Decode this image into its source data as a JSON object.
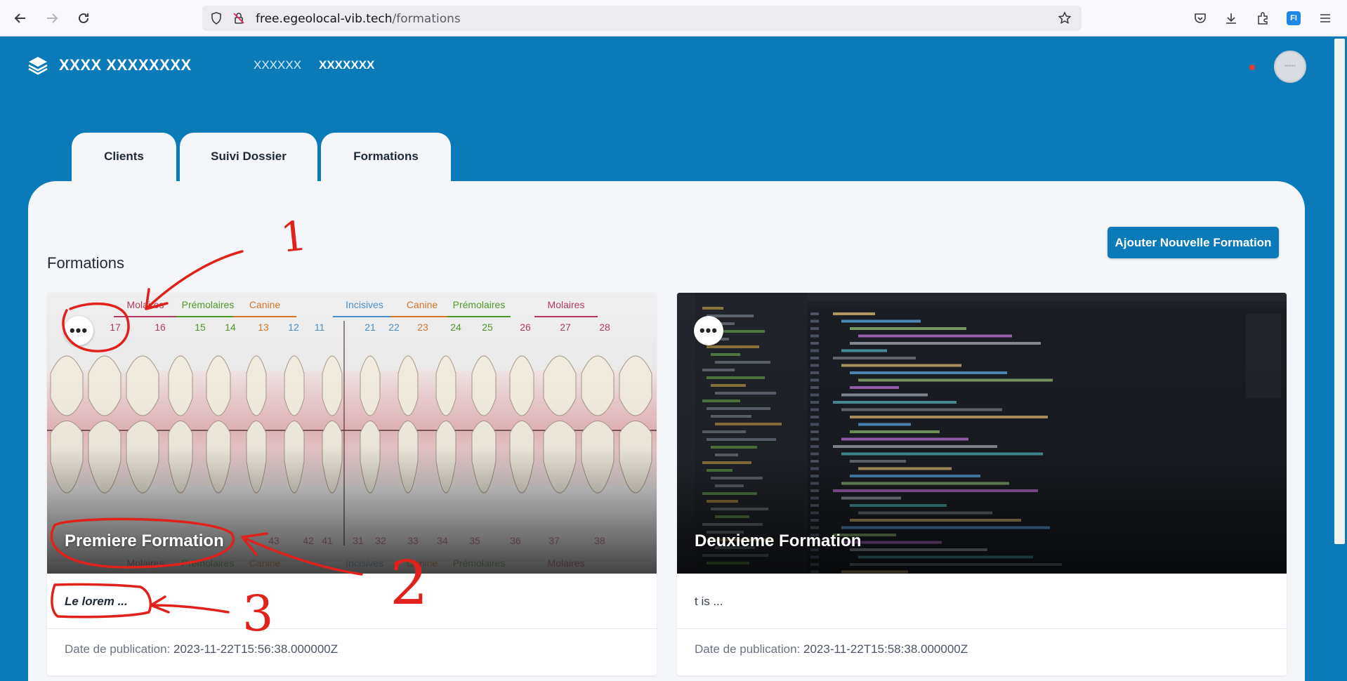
{
  "browser": {
    "url_host": "free.egeolocal-vib.tech",
    "url_path": "/formations",
    "extension_badge": "FI"
  },
  "header": {
    "app_title": "XXXX XXXXXXXX",
    "nav": [
      {
        "label": "XXXXXX",
        "active": false
      },
      {
        "label": "XXXXXXX",
        "active": true
      }
    ],
    "avatar_text": "*****"
  },
  "tabs": [
    {
      "label": "Clients"
    },
    {
      "label": "Suivi Dossier"
    },
    {
      "label": "Formations"
    }
  ],
  "main": {
    "section_title": "Formations",
    "add_button_label": "Ajouter Nouvelle Formation"
  },
  "dental_chart": {
    "top_groups": [
      "Molaires",
      "Prémolaires",
      "Canine",
      "Incisives",
      "Canine",
      "Prémolaires",
      "Molaires"
    ],
    "top_numbers": [
      "17",
      "16",
      "15",
      "14",
      "13",
      "12",
      "11",
      "21",
      "22",
      "23",
      "24",
      "25",
      "26",
      "27",
      "28"
    ],
    "bottom_numbers": [
      "43",
      "42",
      "41",
      "31",
      "32",
      "33",
      "34",
      "35",
      "36",
      "37",
      "38"
    ],
    "bottom_groups": [
      "Molaires",
      "Prémolaires",
      "Canine",
      "Incisives",
      "Canine",
      "Prémolaires",
      "Molaires"
    ]
  },
  "cards": [
    {
      "title": "Premiere Formation",
      "description": "Le lorem ...",
      "date_label": "Date de publication:",
      "date_value": "2023-11-22T15:56:38.000000Z"
    },
    {
      "title": "Deuxieme Formation",
      "description": "t is ...",
      "date_label": "Date de publication:",
      "date_value": "2023-11-22T15:58:38.000000Z"
    }
  ],
  "annotations": {
    "labels": [
      "1",
      "2",
      "3"
    ],
    "color": "#e0211c"
  },
  "colors": {
    "brand": "#0a7bb8",
    "panel": "#f4f6f9"
  }
}
